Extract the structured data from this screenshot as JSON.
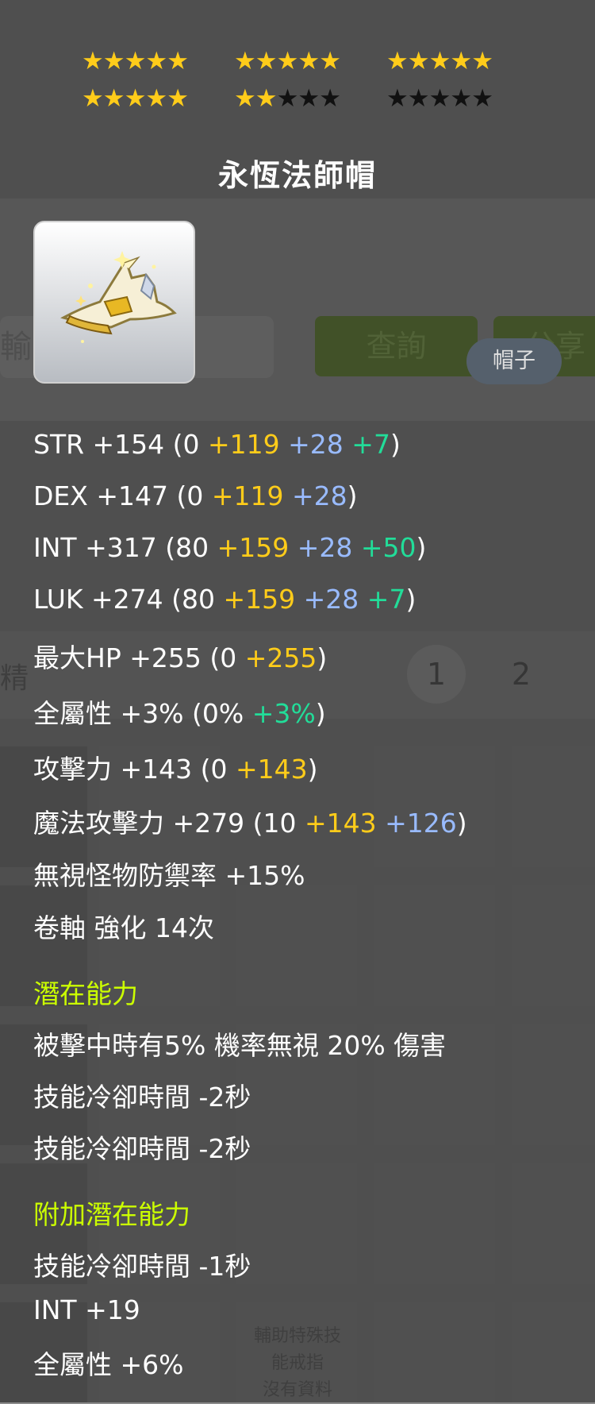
{
  "background": {
    "search_text": "輸入",
    "query_button": "查詢",
    "share_button": "分享",
    "side_label": "精",
    "pages": [
      "1",
      "2"
    ],
    "cell_text": [
      "輔助特殊技",
      "能戒指",
      "沒有資料"
    ]
  },
  "stars": {
    "total": 30,
    "filled": 22,
    "groups_per_row": 3,
    "stars_per_group": 5
  },
  "item": {
    "name": "永恆法師帽",
    "category": "帽子",
    "icon": "mage-hat-icon"
  },
  "stats": [
    {
      "label": "STR +154",
      "parts": [
        {
          "t": " (0 ",
          "c": "w"
        },
        {
          "t": "+119",
          "c": "y"
        },
        {
          "t": " +28",
          "c": "b"
        },
        {
          "t": " +7",
          "c": "g"
        },
        {
          "t": ")",
          "c": "w"
        }
      ]
    },
    {
      "label": "DEX +147",
      "parts": [
        {
          "t": " (0 ",
          "c": "w"
        },
        {
          "t": "+119",
          "c": "y"
        },
        {
          "t": " +28",
          "c": "b"
        },
        {
          "t": ")",
          "c": "w"
        }
      ]
    },
    {
      "label": "INT +317",
      "parts": [
        {
          "t": " (80 ",
          "c": "w"
        },
        {
          "t": "+159",
          "c": "y"
        },
        {
          "t": " +28",
          "c": "b"
        },
        {
          "t": " +50",
          "c": "g"
        },
        {
          "t": ")",
          "c": "w"
        }
      ]
    },
    {
      "label": "LUK +274",
      "parts": [
        {
          "t": " (80 ",
          "c": "w"
        },
        {
          "t": "+159",
          "c": "y"
        },
        {
          "t": " +28",
          "c": "b"
        },
        {
          "t": " +7",
          "c": "g"
        },
        {
          "t": ")",
          "c": "w"
        }
      ]
    },
    {
      "label": "最大HP +255",
      "parts": [
        {
          "t": " (0 ",
          "c": "w"
        },
        {
          "t": "+255",
          "c": "y"
        },
        {
          "t": ")",
          "c": "w"
        }
      ]
    },
    {
      "label": "全屬性 +3%",
      "parts": [
        {
          "t": " (0% ",
          "c": "w"
        },
        {
          "t": "+3%",
          "c": "g"
        },
        {
          "t": ")",
          "c": "w"
        }
      ]
    },
    {
      "label": "攻擊力 +143",
      "parts": [
        {
          "t": "  (0 ",
          "c": "w"
        },
        {
          "t": "+143",
          "c": "y"
        },
        {
          "t": ")",
          "c": "w"
        }
      ]
    },
    {
      "label": "魔法攻擊力 +279",
      "parts": [
        {
          "t": "  (10 ",
          "c": "w"
        },
        {
          "t": "+143",
          "c": "y"
        },
        {
          "t": " +126",
          "c": "b"
        },
        {
          "t": ")",
          "c": "w"
        }
      ]
    },
    {
      "label": "無視怪物防禦率 +15%",
      "parts": []
    },
    {
      "label": "卷軸 強化 14次",
      "parts": []
    }
  ],
  "potential": {
    "title": "潛在能力",
    "lines": [
      "被擊中時有5% 機率無視 20% 傷害",
      "技能冷卻時間 -2秒",
      "技能冷卻時間 -2秒"
    ]
  },
  "additional_potential": {
    "title": "附加潛在能力",
    "lines": [
      "技能冷卻時間 -1秒",
      "INT +19",
      "全屬性 +6%"
    ]
  },
  "colors": {
    "star_on": "#ffcc1a",
    "star_off": "#111111",
    "base": "#ffffff",
    "flame": "#ffcc1a",
    "scroll": "#99bbff",
    "star_bonus": "#22dd99",
    "section_title": "#ccff00"
  }
}
